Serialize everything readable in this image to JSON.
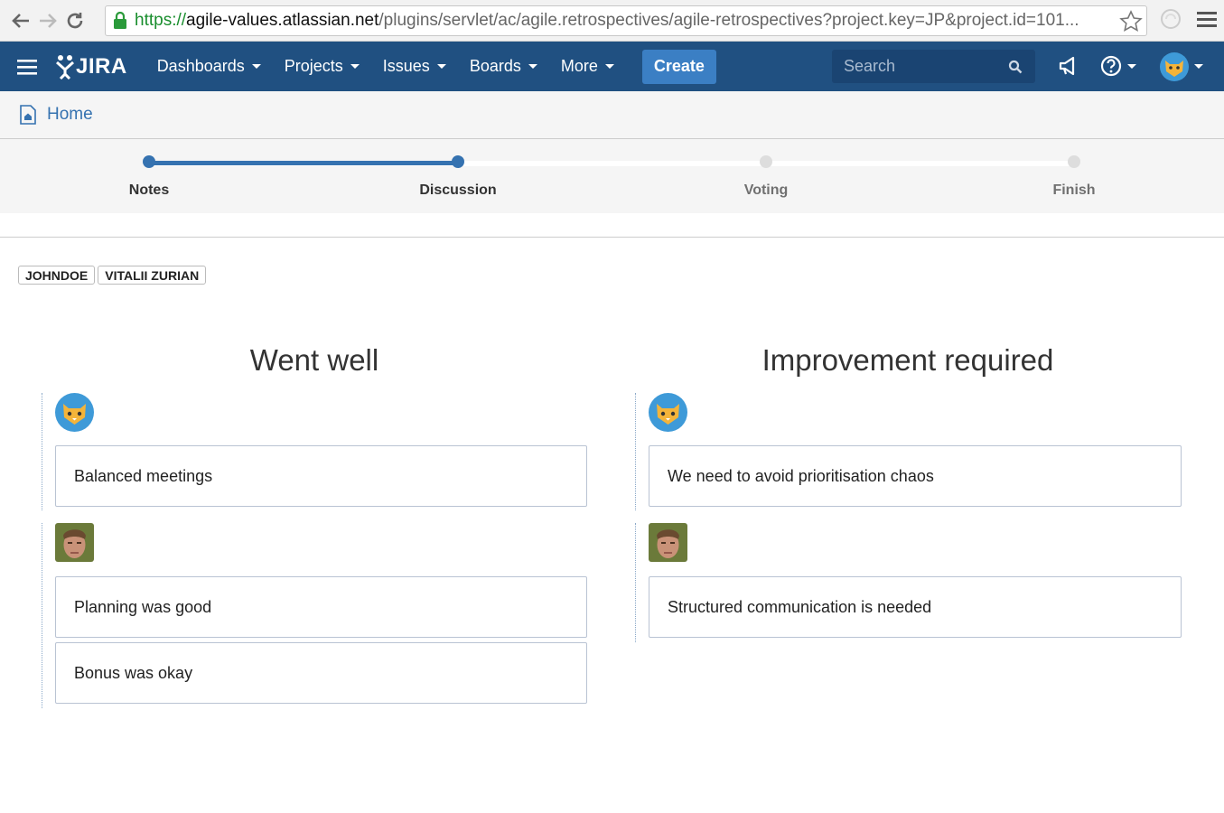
{
  "browser": {
    "url_scheme": "https://",
    "url_host": "agile-values.atlassian.net",
    "url_rest": "/plugins/servlet/ac/agile.retrospectives/agile-retrospectives?project.key=JP&project.id=101..."
  },
  "header": {
    "logo_text": "JIRA",
    "nav": [
      {
        "label": "Dashboards"
      },
      {
        "label": "Projects"
      },
      {
        "label": "Issues"
      },
      {
        "label": "Boards"
      },
      {
        "label": "More"
      }
    ],
    "create_label": "Create",
    "search_placeholder": "Search",
    "accent": "#205081"
  },
  "breadcrumb": {
    "home_label": "Home"
  },
  "stepper": {
    "steps": [
      {
        "label": "Notes",
        "done": true
      },
      {
        "label": "Discussion",
        "done": true
      },
      {
        "label": "Voting",
        "done": false
      },
      {
        "label": "Finish",
        "done": false
      }
    ]
  },
  "participants": [
    "JOHNDOE",
    "VITALII ZURIAN"
  ],
  "columns": [
    {
      "title": "Went well",
      "groups": [
        {
          "avatar": "cat-avatar",
          "notes": [
            "Balanced meetings"
          ]
        },
        {
          "avatar": "photo-avatar",
          "notes": [
            "Planning was good",
            "Bonus was okay"
          ]
        }
      ]
    },
    {
      "title": "Improvement required",
      "groups": [
        {
          "avatar": "cat-avatar",
          "notes": [
            "We need to avoid prioritisation chaos"
          ]
        },
        {
          "avatar": "photo-avatar",
          "notes": [
            "Structured communication is needed"
          ]
        }
      ]
    }
  ]
}
